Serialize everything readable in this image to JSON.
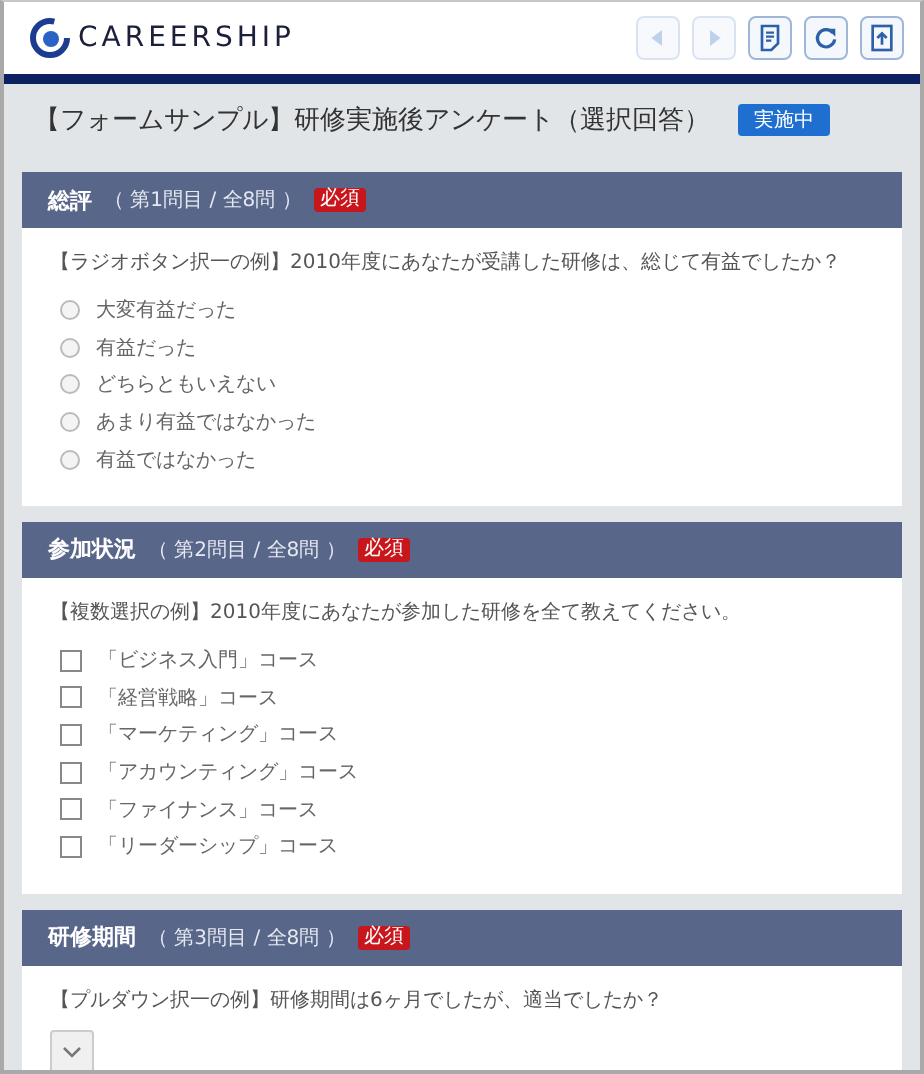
{
  "header": {
    "logo": "CAREERSHIP",
    "toolbar": [
      {
        "kind": "prev",
        "disabled": true
      },
      {
        "kind": "next",
        "disabled": true
      },
      {
        "kind": "document",
        "disabled": false
      },
      {
        "kind": "refresh",
        "disabled": false
      },
      {
        "kind": "upload",
        "disabled": false
      }
    ]
  },
  "page_title": "【フォームサンプル】研修実施後アンケート（選択回答）",
  "status_badge": "実施中",
  "questions": [
    {
      "title": "総評",
      "counter": "（ 第1問目 / 全8問 ）",
      "required_badge": "必須",
      "prompt": "【ラジオボタン択一の例】2010年度にあなたが受講した研修は、総じて有益でしたか？",
      "kind": "radio",
      "options": [
        {
          "label": "大変有益だった",
          "selected": false
        },
        {
          "label": "有益だった",
          "selected": false
        },
        {
          "label": "どちらともいえない",
          "selected": false
        },
        {
          "label": "あまり有益ではなかった",
          "selected": false
        },
        {
          "label": "有益ではなかった",
          "selected": false
        }
      ]
    },
    {
      "title": "参加状況",
      "counter": "（ 第2問目 / 全8問 ）",
      "required_badge": "必須",
      "prompt": "【複数選択の例】2010年度にあなたが参加した研修を全て教えてください。",
      "kind": "checkbox",
      "options": [
        {
          "label": "「ビジネス入門」コース",
          "checked": false
        },
        {
          "label": "「経営戦略」コース",
          "checked": false
        },
        {
          "label": "「マーケティング」コース",
          "checked": false
        },
        {
          "label": "「アカウンティング」コース",
          "checked": false
        },
        {
          "label": "「ファイナンス」コース",
          "checked": false
        },
        {
          "label": "「リーダーシップ」コース",
          "checked": false
        }
      ]
    },
    {
      "title": "研修期間",
      "counter": "（ 第3問目 / 全8問 ）",
      "required_badge": "必須",
      "prompt": "【プルダウン択一の例】研修期間は6ヶ月でしたが、適当でしたか？",
      "kind": "dropdown"
    }
  ]
}
